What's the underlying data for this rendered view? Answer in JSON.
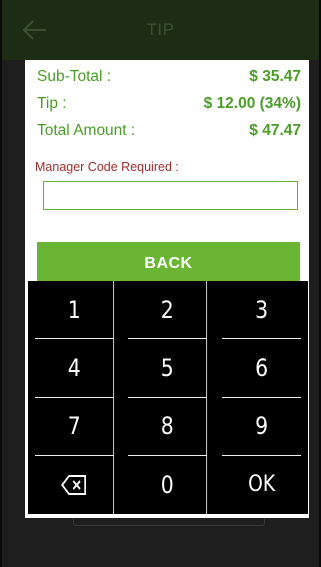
{
  "app_bar": {
    "title": "TIP",
    "back_icon": "arrow-left-icon"
  },
  "dialog": {
    "subtotal": {
      "label": "Sub-Total :",
      "value": "$ 35.47"
    },
    "tip": {
      "label": "Tip :",
      "value": "$ 12.00 (34%)"
    },
    "total": {
      "label": "Total Amount :",
      "value": "$ 47.47"
    },
    "manager_code": {
      "label": "Manager Code Required :",
      "value": "",
      "placeholder": ""
    },
    "back_button": "BACK"
  },
  "keypad": {
    "keys": [
      "1",
      "2",
      "3",
      "4",
      "5",
      "6",
      "7",
      "8",
      "9",
      "",
      "0",
      "OK"
    ],
    "backspace_icon": "backspace-icon"
  },
  "colors": {
    "accent_green": "#6ab534",
    "text_green": "#4a9d28",
    "warning_red": "#a12d2d",
    "keypad_bg": "#000000"
  }
}
